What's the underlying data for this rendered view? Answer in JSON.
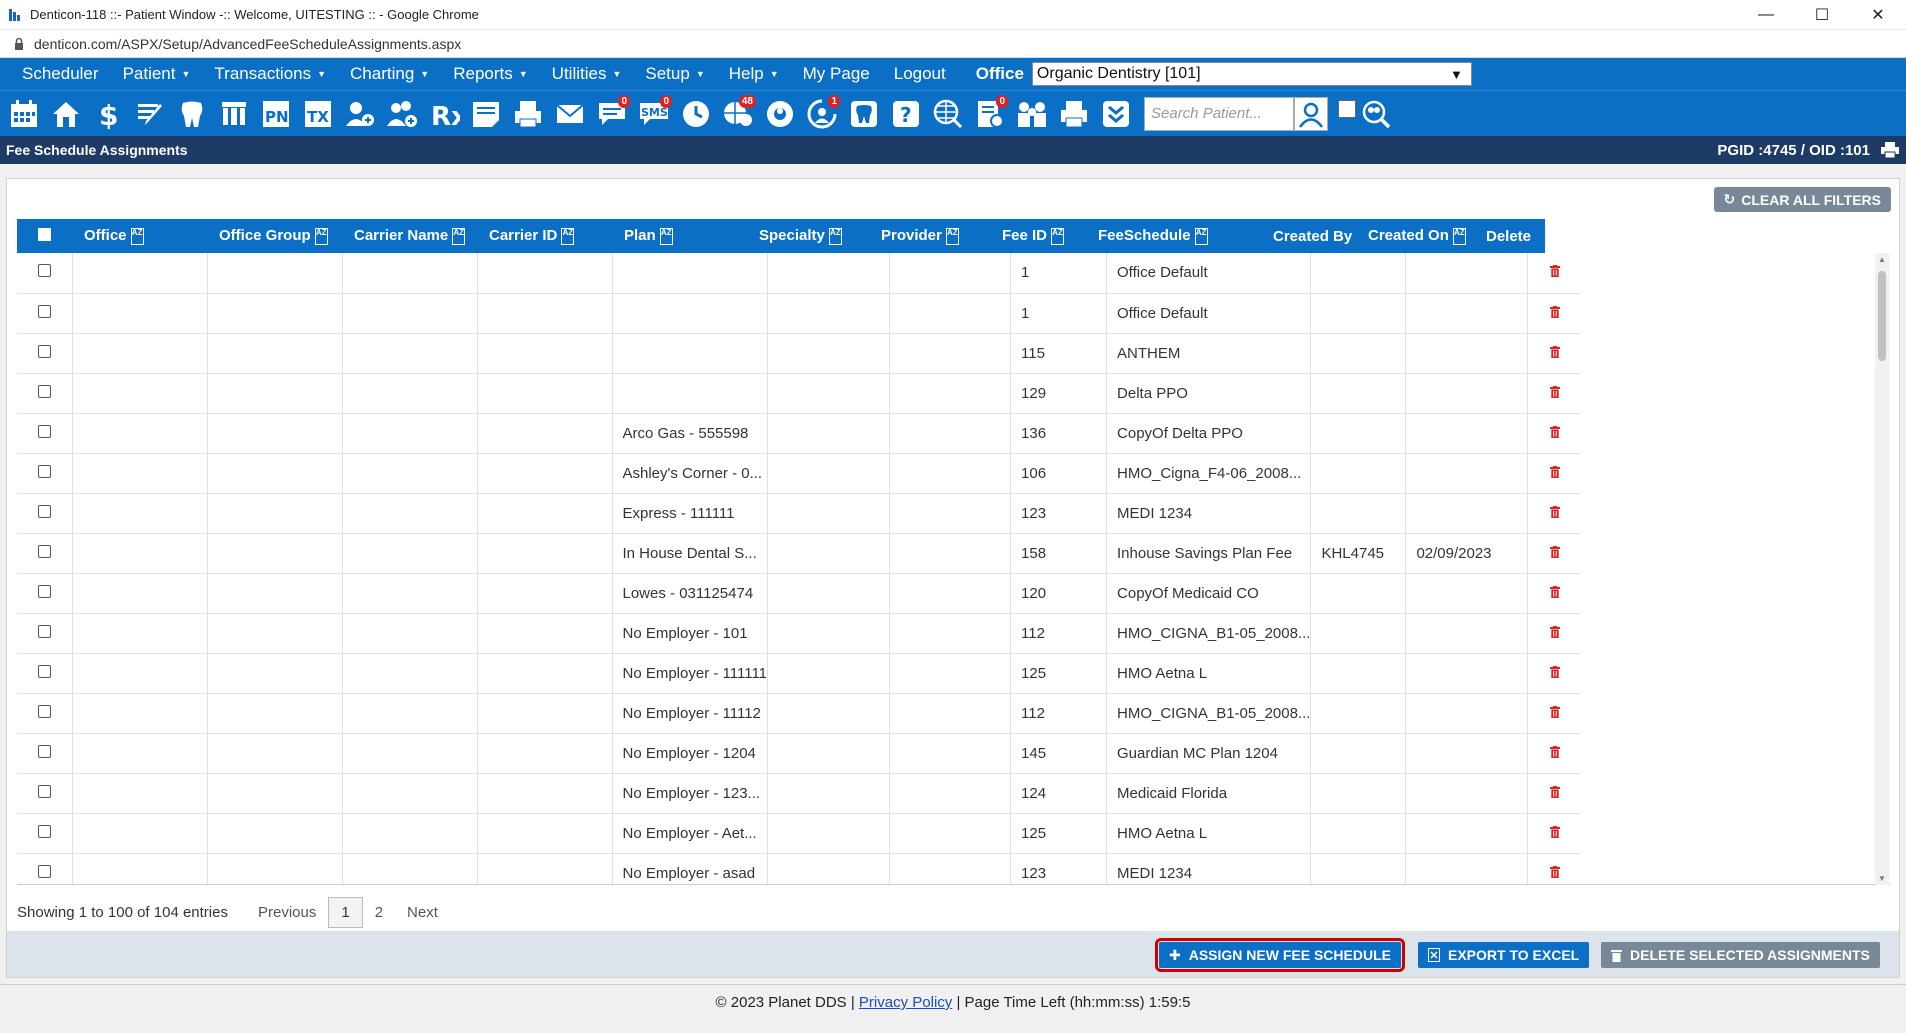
{
  "window": {
    "title": "Denticon-118 ::- Patient Window -:: Welcome, UITESTING :: - Google Chrome",
    "url": "denticon.com/ASPX/Setup/AdvancedFeeScheduleAssignments.aspx"
  },
  "menu": {
    "items": [
      {
        "label": "Scheduler",
        "caret": false
      },
      {
        "label": "Patient",
        "caret": true
      },
      {
        "label": "Transactions",
        "caret": true
      },
      {
        "label": "Charting",
        "caret": true
      },
      {
        "label": "Reports",
        "caret": true
      },
      {
        "label": "Utilities",
        "caret": true
      },
      {
        "label": "Setup",
        "caret": true
      },
      {
        "label": "Help",
        "caret": true
      },
      {
        "label": "My Page",
        "caret": false
      },
      {
        "label": "Logout",
        "caret": false
      }
    ],
    "office_label": "Office",
    "office_value": "Organic Dentistry [101]"
  },
  "toolbar": {
    "badges": {
      "messages": "0",
      "sms": "0",
      "globe": "48",
      "refresh": "1",
      "claims": "0"
    },
    "search_placeholder": "Search Patient..."
  },
  "page": {
    "title": "Fee Schedule Assignments",
    "pgid": "PGID :4745  /  OID :101"
  },
  "clear_filters": "CLEAR ALL FILTERS",
  "table": {
    "columns": [
      "Office",
      "Office Group",
      "Carrier Name",
      "Carrier ID",
      "Plan",
      "Specialty",
      "Provider",
      "Fee ID",
      "FeeSchedule",
      "Created By",
      "Created On",
      "Delete"
    ],
    "rows": [
      {
        "plan": "",
        "fee_id": "1",
        "fee_schedule": "Office Default",
        "created_by": "",
        "created_on": ""
      },
      {
        "plan": "",
        "fee_id": "1",
        "fee_schedule": "Office Default",
        "created_by": "",
        "created_on": ""
      },
      {
        "plan": "",
        "fee_id": "115",
        "fee_schedule": "ANTHEM",
        "created_by": "",
        "created_on": ""
      },
      {
        "plan": "",
        "fee_id": "129",
        "fee_schedule": "Delta PPO",
        "created_by": "",
        "created_on": ""
      },
      {
        "plan": "Arco Gas - 555598",
        "fee_id": "136",
        "fee_schedule": "CopyOf Delta PPO",
        "created_by": "",
        "created_on": ""
      },
      {
        "plan": "Ashley's Corner - 0...",
        "fee_id": "106",
        "fee_schedule": "HMO_Cigna_F4-06_2008...",
        "created_by": "",
        "created_on": ""
      },
      {
        "plan": "Express - 111111",
        "fee_id": "123",
        "fee_schedule": "MEDI 1234",
        "created_by": "",
        "created_on": ""
      },
      {
        "plan": "In House Dental S...",
        "fee_id": "158",
        "fee_schedule": "Inhouse Savings Plan Fee",
        "created_by": "KHL4745",
        "created_on": "02/09/2023"
      },
      {
        "plan": "Lowes - 031125474",
        "fee_id": "120",
        "fee_schedule": "CopyOf Medicaid CO",
        "created_by": "",
        "created_on": ""
      },
      {
        "plan": "No Employer - 101",
        "fee_id": "112",
        "fee_schedule": "HMO_CIGNA_B1-05_2008...",
        "created_by": "",
        "created_on": ""
      },
      {
        "plan": "No Employer - 111111",
        "fee_id": "125",
        "fee_schedule": "HMO Aetna L",
        "created_by": "",
        "created_on": ""
      },
      {
        "plan": "No Employer - 11112",
        "fee_id": "112",
        "fee_schedule": "HMO_CIGNA_B1-05_2008...",
        "created_by": "",
        "created_on": ""
      },
      {
        "plan": "No Employer - 1204",
        "fee_id": "145",
        "fee_schedule": "Guardian MC Plan 1204",
        "created_by": "",
        "created_on": ""
      },
      {
        "plan": "No Employer - 123...",
        "fee_id": "124",
        "fee_schedule": "Medicaid Florida",
        "created_by": "",
        "created_on": ""
      },
      {
        "plan": "No Employer - Aet...",
        "fee_id": "125",
        "fee_schedule": "HMO Aetna L",
        "created_by": "",
        "created_on": ""
      },
      {
        "plan": "No Employer - asad",
        "fee_id": "123",
        "fee_schedule": "MEDI 1234",
        "created_by": "",
        "created_on": ""
      }
    ]
  },
  "pager": {
    "info": "Showing 1 to 100 of 104 entries",
    "previous": "Previous",
    "current": "1",
    "page2": "2",
    "next": "Next"
  },
  "actions": {
    "assign": "ASSIGN NEW FEE SCHEDULE",
    "export": "EXPORT TO EXCEL",
    "delete_selected": "DELETE SELECTED ASSIGNMENTS"
  },
  "footer": {
    "copyright": "© 2023 Planet DDS |",
    "privacy": "Privacy Policy",
    "time_left": "| Page Time Left (hh:mm:ss) 1:59:5"
  }
}
